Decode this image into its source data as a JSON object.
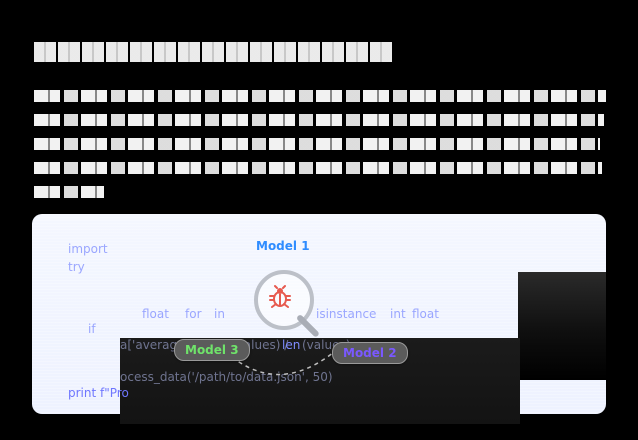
{
  "code": {
    "lines": [
      "import",
      "try",
      "float",
      "for",
      "in",
      "isinstance",
      "int",
      "float",
      "if",
      "a['average'] = ",
      "(values) / ",
      "len",
      "(values)",
      "ocess_data('/path/to/data.json', 50)",
      "print f\"Pro"
    ]
  },
  "labels": {
    "model_1": "Model 1",
    "model_2": "Model 2",
    "model_3": "Model 3"
  },
  "icons": {
    "magnifier": "magnifier-icon",
    "bug": "bug-icon"
  },
  "colors": {
    "model_1": "#2f8cff",
    "model_2": "#7a58ff",
    "model_3": "#6fe36a",
    "bug": "#e75a4f"
  }
}
